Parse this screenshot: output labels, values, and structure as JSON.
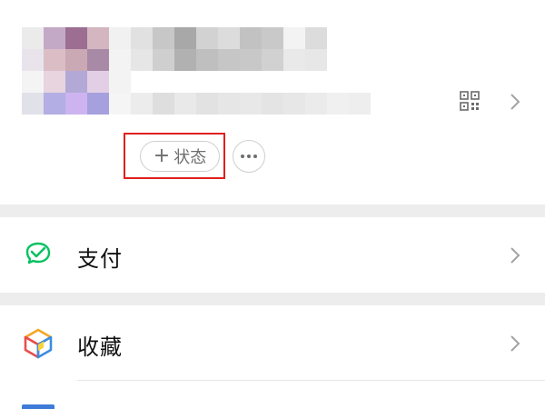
{
  "profile": {
    "mosaic": {
      "avatar": [
        "#ebebeb",
        "#c3a9c5",
        "#9b6e92",
        "#d3b6c0",
        "#f1f1f1",
        "#e9e4ec",
        "#dbbdc6",
        "#caa9b4",
        "#a88aa6",
        "#f3f3f3",
        "#f4f4f4",
        "#e7d4df",
        "#b3a9d6",
        "#e2cfe5",
        "#f3f3f3",
        "#e1e1e9",
        "#b3aee3",
        "#cdb4f0",
        "#a6a0de",
        "#f5f5f5"
      ],
      "name": [
        "#e1e1e1",
        "#c7c7c7",
        "#a8a8a8",
        "#d2d2d2",
        "#dcdcdc",
        "#c2c2c2",
        "#c9c9c9",
        "#f3f3f3",
        "#dcdcdc",
        "#e6e6e6",
        "#cfcfcf",
        "#b1b1b1",
        "#bfbfbf",
        "#c6c6c6",
        "#c8c8c8",
        "#d1d1d1",
        "#e9e9e9",
        "#e7e7e7"
      ],
      "id": [
        "#ececec",
        "#dedede",
        "#e9e9e9",
        "#e2e2e2",
        "#e6e6e6",
        "#e8e8e8",
        "#e4e4e4",
        "#e7e7e7",
        "#ebebeb",
        "#f0f0f0",
        "#eeeeee"
      ]
    },
    "status_button": {
      "plus": "+",
      "label": "状态"
    },
    "qr_icon": "qr-code-icon",
    "chevron_icon": "chevron-right-icon"
  },
  "menu": [
    {
      "label": "支付",
      "icon": "wechat-pay-icon",
      "icon_color": "#07c160"
    },
    {
      "label": "收藏",
      "icon": "favorites-cube-icon",
      "icon_colors": [
        "#f5a623",
        "#e94d4d",
        "#3b8de0",
        "#f8d23a"
      ]
    }
  ],
  "colors": {
    "highlight_border": "#e0201c",
    "divider_band": "#ededed",
    "text_primary": "#111111",
    "text_secondary": "#6e6e6e"
  }
}
